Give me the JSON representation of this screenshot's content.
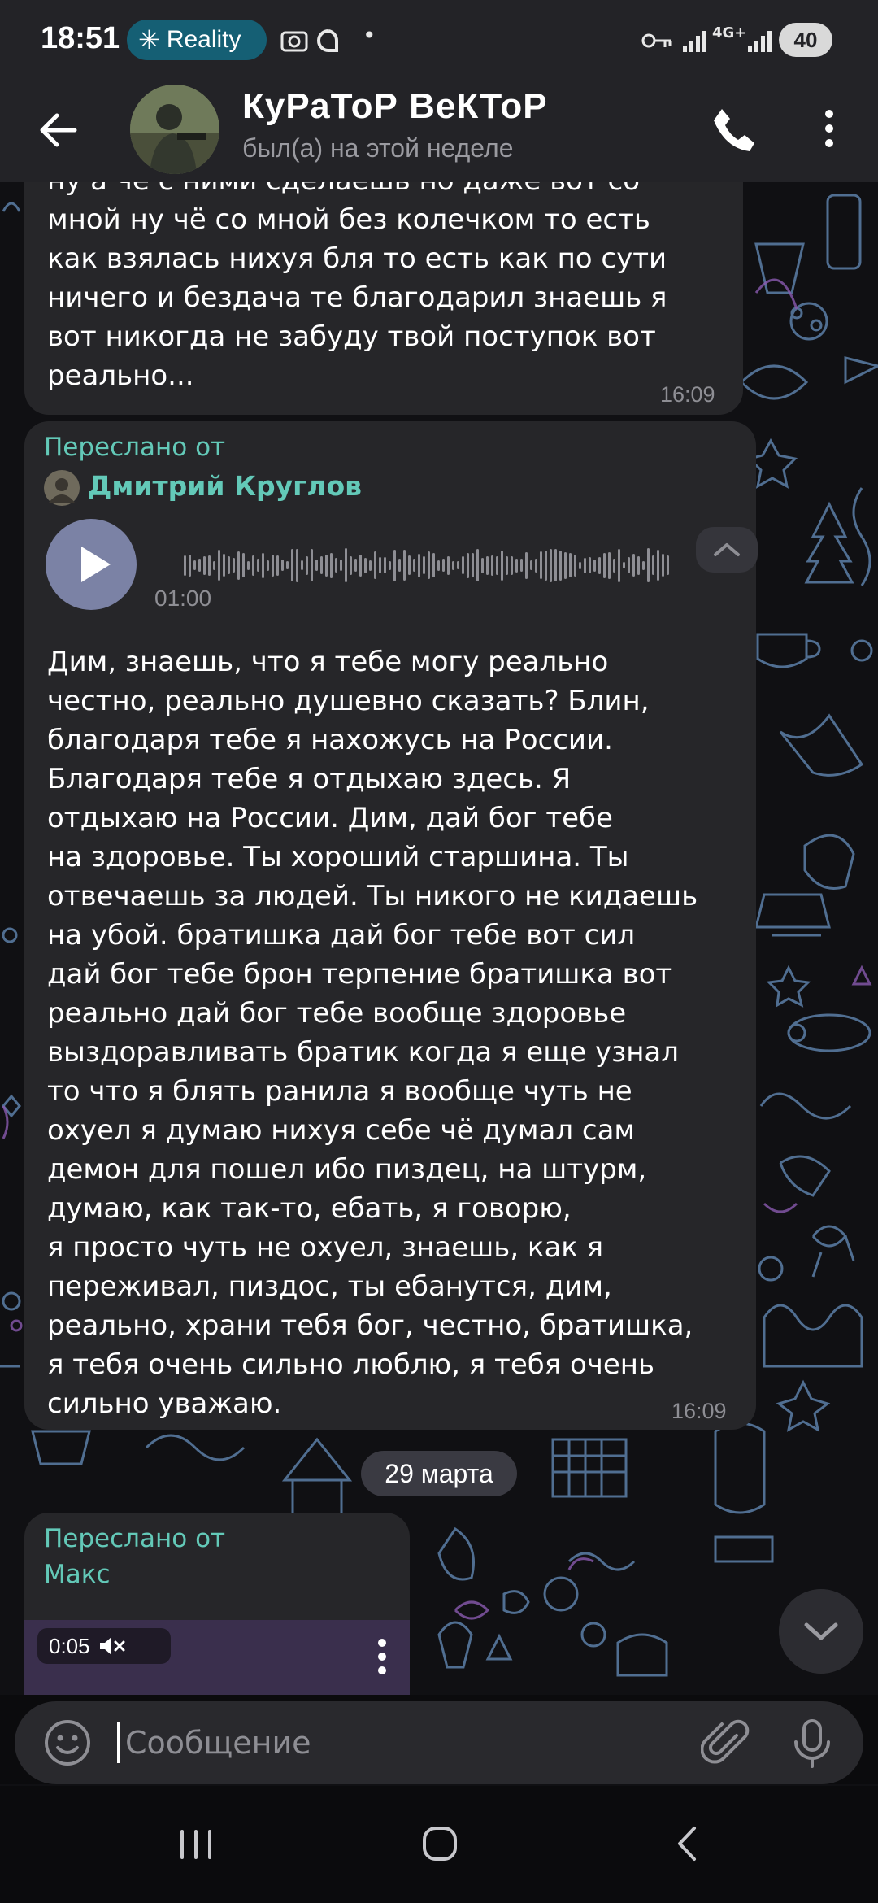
{
  "status_bar": {
    "time": "18:51",
    "reality_label": "Reality",
    "battery": "40",
    "network": "4G+"
  },
  "header": {
    "title": "КуРаТоР ВеКТоР",
    "subtitle": "был(а) на этой неделе"
  },
  "messages": {
    "first": {
      "text": "ну а чё с ними сделаешь но даже вот со\nмной ну чё со мной без колечком то есть\nкак взялась нихуя бля то есть как по сути\nничего и бездача те благодарил знаешь я\nвот никогда не забуду твой поступок вот\nреально...",
      "time": "16:09"
    },
    "second": {
      "forwarded_label": "Переслано от",
      "forwarded_name": "Дмитрий Круглов",
      "voice_duration": "01:00",
      "text": "Дим, знаешь, что я тебе могу реально\nчестно, реально душевно сказать? Блин,\nблагодаря тебе я нахожусь на России.\nБлагодаря тебе я отдыхаю здесь. Я\nотдыхаю на России. Дим, дай бог тебе\nна здоровье. Ты хороший старшина. Ты\nотвечаешь за людей. Ты никого не кидаешь\nна убой. братишка дай бог тебе вот сил\nдай бог тебе брон терпение братишка вот\nреально дай бог тебе вообще здоровье\nвыздоравливать братик когда я еще узнал\nто что я блять ранила я вообще чуть не\nохуел я думаю нихуя себе чё думал сам\nдемон для пошел ибо пиздец, на штурм,\nдумаю, как так-то, ебать, я говорю,\nя просто чуть не охуел, знаешь, как я\nпереживал, пиздос, ты ебанутся, дим,\nреально, храни тебя бог, честно, братишка,\nя тебя очень сильно люблю, я тебя очень\nсильно уважаю.",
      "time": "16:09"
    },
    "date_separator": "29 марта",
    "third": {
      "forwarded_label": "Переслано от",
      "forwarded_name": "Макс",
      "video_duration": "0:05"
    }
  },
  "input": {
    "placeholder": "Сообщение"
  },
  "colors": {
    "accent": "#63c9b8",
    "bubble": "#262629",
    "header": "#232327",
    "play_button": "#7b82a5"
  },
  "icons": [
    "back-arrow-icon",
    "phone-icon",
    "more-vertical-icon",
    "play-icon",
    "chevron-up-icon",
    "mute-icon",
    "chevron-down-icon",
    "emoji-icon",
    "paperclip-icon",
    "microphone-icon",
    "recent-apps-icon",
    "home-icon",
    "back-nav-icon"
  ]
}
